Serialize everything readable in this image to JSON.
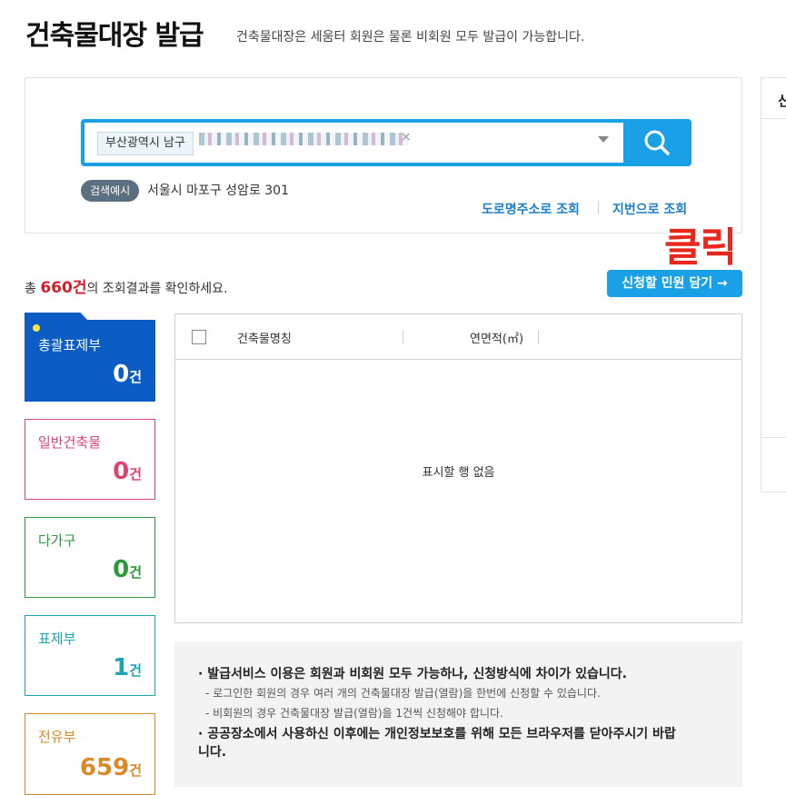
{
  "header": {
    "title": "건축물대장 발급",
    "subtitle": "건축물대장은 세움터 회원은 물론 비회원 모두 발급이 가능합니다."
  },
  "search": {
    "region_chip": "부산광역시 남구",
    "example_badge": "검색예시",
    "example_text": "서울시 마포구 성암로 301",
    "road_link": "도로명주소로 조회",
    "lot_link": "지번으로 조회",
    "search_icon": "search-icon"
  },
  "annotation": {
    "click_label": "클릭"
  },
  "results": {
    "prefix": "총 ",
    "count": "660건",
    "suffix": "의 조회결과를 확인하세요.",
    "apply_button": "신청할 민원 담기 →"
  },
  "right_panel": {
    "title_partial": "신"
  },
  "categories": [
    {
      "label": "총괄표제부",
      "count": "0",
      "unit": "건",
      "color": "#0b5cc5"
    },
    {
      "label": "일반건축물",
      "count": "0",
      "unit": "건",
      "color": "#d9476f"
    },
    {
      "label": "다가구",
      "count": "0",
      "unit": "건",
      "color": "#2a9a3c"
    },
    {
      "label": "표제부",
      "count": "1",
      "unit": "건",
      "color": "#1ea5b4"
    },
    {
      "label": "전유부",
      "count": "659",
      "unit": "건",
      "color": "#d98a2a"
    }
  ],
  "table": {
    "columns": [
      "건축물명칭",
      "연면적(㎡)"
    ],
    "empty_message": "표시할 행 없음"
  },
  "notice": {
    "main1": "· 발급서비스 이용은 회원과 비회원 모두 가능하나, 신청방식에 차이가 있습니다.",
    "sub1": "- 로그인한 회원의 경우 여러 개의 건축물대장 발급(열람)을 한번에 신청할 수 있습니다.",
    "sub2": "- 비회원의 경우 건축물대장 발급(열람)을 1건씩 신청해야 합니다.",
    "main2": "· 공공장소에서 사용하신 이후에는 개인정보보호를 위해 모든 브라우저를 닫아주시기 바랍니다."
  },
  "colors": {
    "accent": "#19a0e6",
    "total_card": "#0b5cc5",
    "highlight_red": "#e8281e"
  }
}
